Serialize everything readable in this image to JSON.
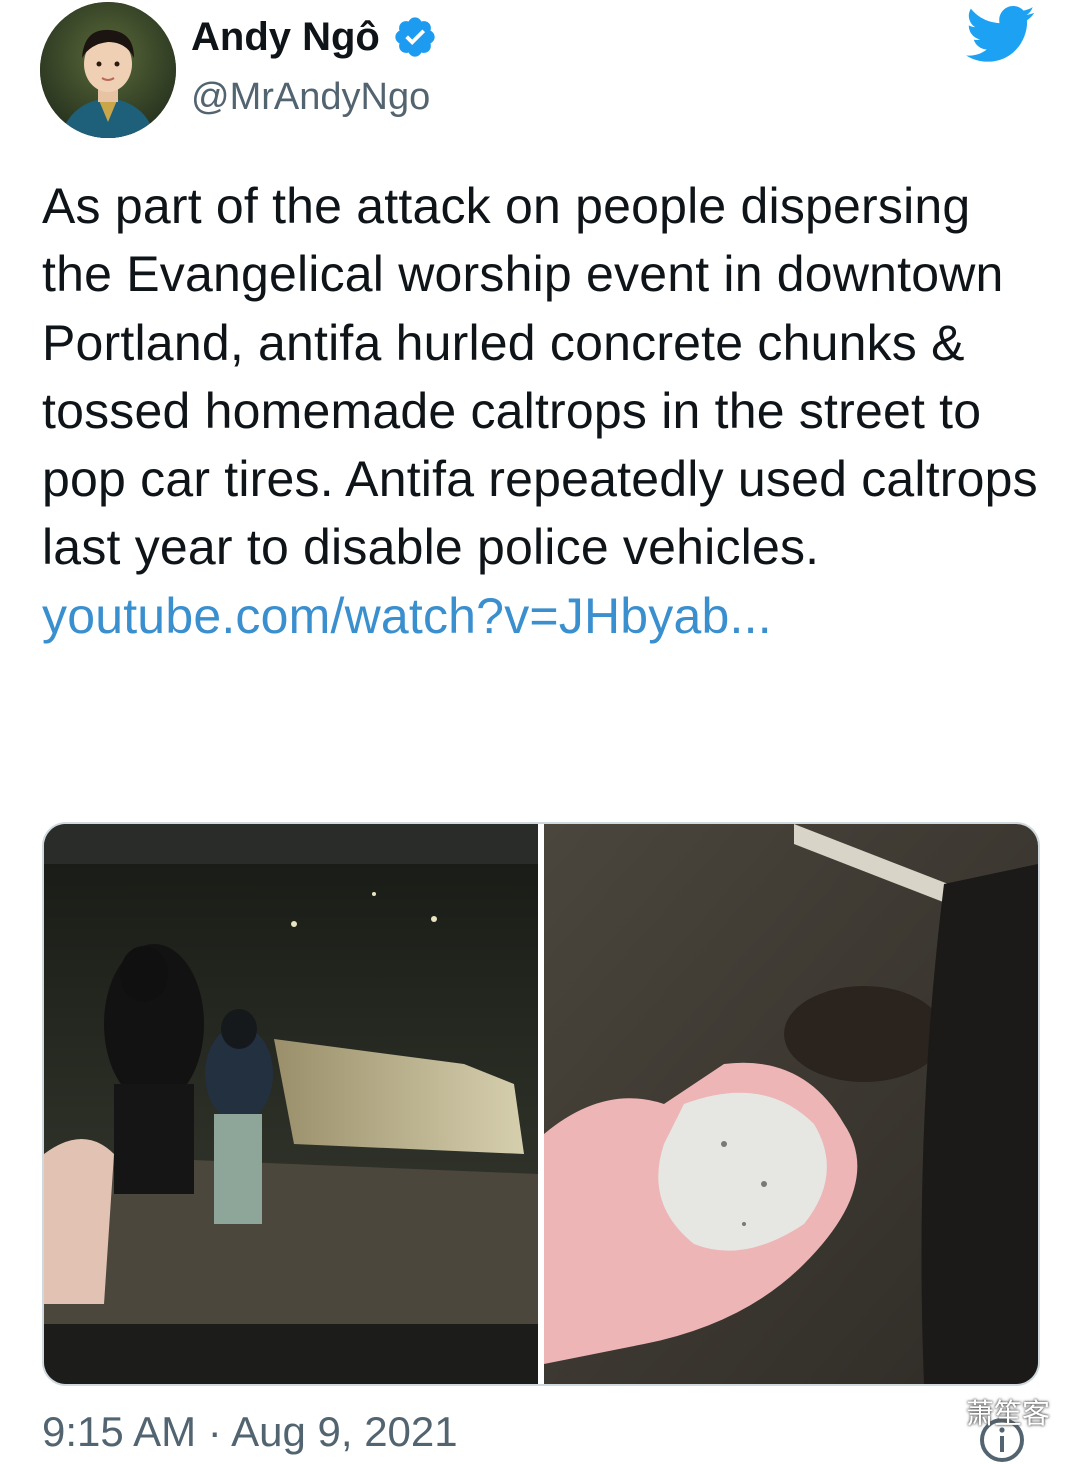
{
  "author": {
    "name": "Andy Ngô",
    "handle": "@MrAndyNgo",
    "verified": true,
    "icons": [
      "verified-badge-icon",
      "twitter-bird-icon"
    ]
  },
  "tweet": {
    "text": "As part of the attack on people dispersing the Evangelical worship event in downtown Portland, antifa hurled concrete chunks & tossed homemade caltrops in the street to pop car tires. Antifa repeatedly used caltrops last year to disable police vehicles. ",
    "link": "youtube.com/watch?v=JHbyab..."
  },
  "footer": {
    "timestamp": "9:15 AM · Aug 9, 2021"
  },
  "watermark": {
    "label": "萧笙客"
  },
  "colors": {
    "link": "#3a8fcf",
    "verified": "#1d9bf0",
    "bird": "#1da1f2",
    "secondary_text": "#536471"
  }
}
